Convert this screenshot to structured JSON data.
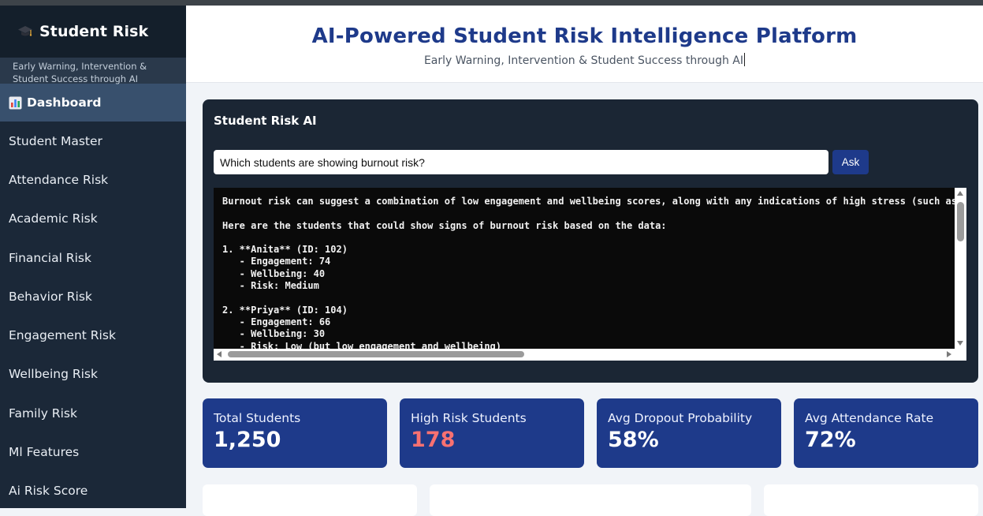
{
  "sidebar": {
    "brand_title": "Student Risk",
    "tagline": "Early Warning, Intervention & Student Success through AI",
    "items": [
      {
        "label": "Dashboard",
        "active": true
      },
      {
        "label": "Student Master"
      },
      {
        "label": "Attendance Risk"
      },
      {
        "label": "Academic Risk"
      },
      {
        "label": "Financial Risk"
      },
      {
        "label": "Behavior Risk"
      },
      {
        "label": "Engagement Risk"
      },
      {
        "label": "Wellbeing Risk"
      },
      {
        "label": "Family Risk"
      },
      {
        "label": "Ml Features"
      },
      {
        "label": "Ai Risk Score"
      }
    ]
  },
  "header": {
    "title": "AI-Powered Student Risk Intelligence Platform",
    "subtitle": "Early Warning, Intervention & Student Success through AI"
  },
  "ai_panel": {
    "title": "Student Risk AI",
    "question": "Which students are showing burnout risk?",
    "ask_label": "Ask",
    "response": "Burnout risk can suggest a combination of low engagement and wellbeing scores, along with any indications of high stress (such as\n\nHere are the students that could show signs of burnout risk based on the data:\n\n1. **Anita** (ID: 102)\n   - Engagement: 74\n   - Wellbeing: 40\n   - Risk: Medium\n\n2. **Priya** (ID: 104)\n   - Engagement: 66\n   - Wellbeing: 30\n   - Risk: Low (but low engagement and wellbeing)"
  },
  "kpis": [
    {
      "label": "Total Students",
      "value": "1,250"
    },
    {
      "label": "High Risk Students",
      "value": "178",
      "alert": true
    },
    {
      "label": "Avg Dropout Probability",
      "value": "58%"
    },
    {
      "label": "Avg Attendance Rate",
      "value": "72%"
    }
  ],
  "colors": {
    "sidebar_bg": "#1b2838",
    "accent": "#1e3a8a",
    "alert": "#f87171",
    "panel_bg": "#1b2634"
  }
}
